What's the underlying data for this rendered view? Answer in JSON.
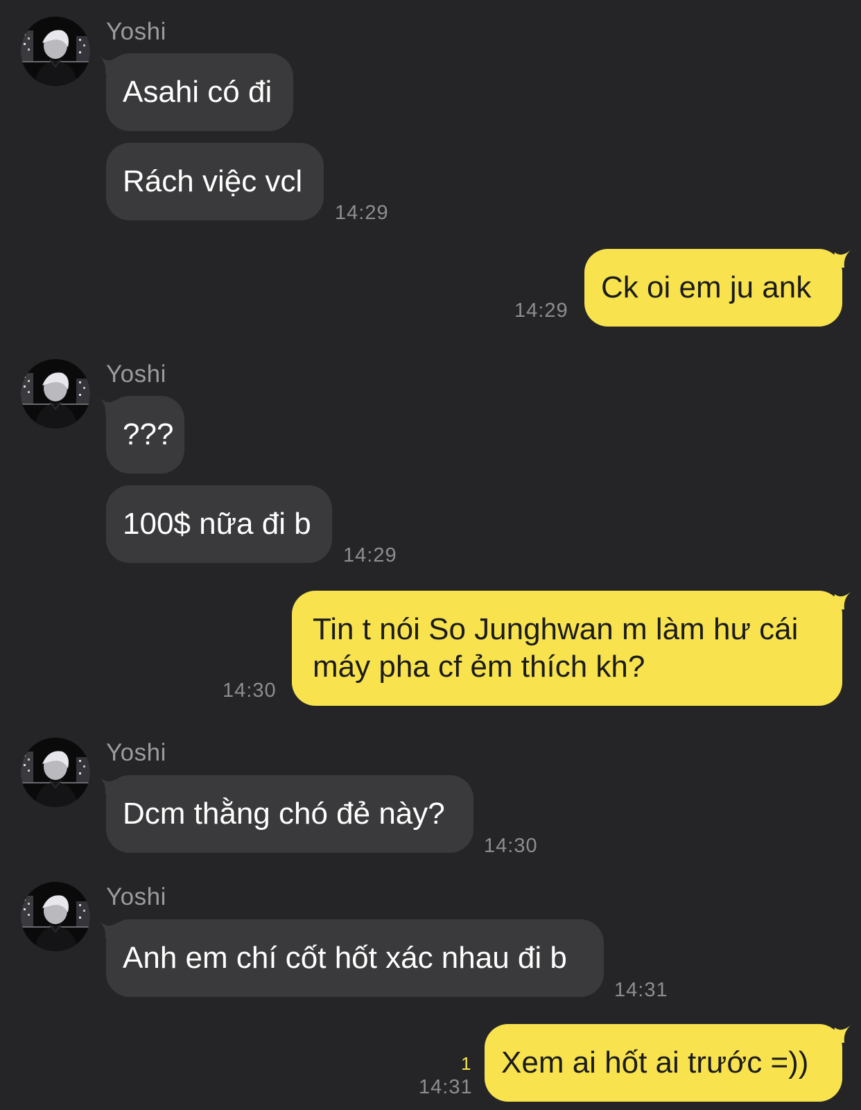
{
  "colors": {
    "background": "#252527",
    "incoming_bubble": "#3a3a3c",
    "outgoing_bubble": "#f8e34e",
    "timestamp": "#8e8e90",
    "unread_count": "#f8e34e"
  },
  "messages": {
    "g1": {
      "sender": "Yoshi",
      "msg1": "Asahi có đi",
      "msg2": "Rách việc vcl",
      "time": "14:29"
    },
    "o1": {
      "text": "Ck oi em ju ank",
      "time": "14:29"
    },
    "g2": {
      "sender": "Yoshi",
      "msg1": "???",
      "msg2": "100$ nữa đi b",
      "time": "14:29"
    },
    "o2": {
      "line1": "Tin t nói So Junghwan m làm hư cái",
      "line2": "máy pha cf ẻm thích kh?",
      "time": "14:30"
    },
    "g3": {
      "sender": "Yoshi",
      "msg1": "Dcm thằng chó đẻ này?",
      "time": "14:30"
    },
    "g4": {
      "sender": "Yoshi",
      "msg1": "Anh em chí cốt hốt xác nhau đi b",
      "time": "14:31"
    },
    "o3": {
      "text": "Xem ai hốt ai trước =))",
      "unread": "1",
      "time": "14:31"
    }
  }
}
